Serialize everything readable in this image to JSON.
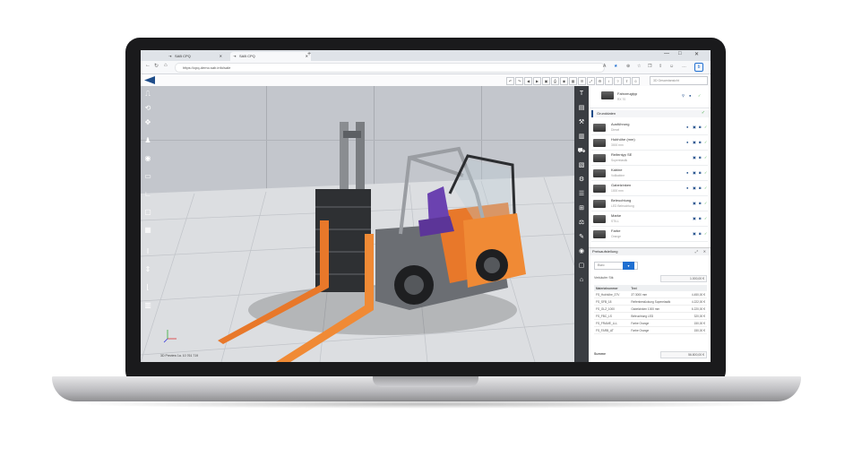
{
  "browser": {
    "tabs": [
      {
        "label": "SAB CPQ",
        "icon": "link-icon",
        "active": false
      },
      {
        "label": "SAB CPQ",
        "icon": "link-icon",
        "active": true
      }
    ],
    "new_tab": "+",
    "window_controls": [
      "—",
      "□",
      "✕"
    ],
    "url": "https://cpq-demo.sab.info/sale"
  },
  "viewport": {
    "coordinates": "3D Preview 1a. 10 761 719"
  },
  "toolbar": {
    "search_placeholder": "3D Gesamtansicht"
  },
  "right_panel": {
    "header": {
      "title": "Fahrzeugtyp",
      "subtitle": "RX 70"
    },
    "section_label": "Grunddaten",
    "items": [
      {
        "title": "Ausführung",
        "subtitle": "Diesel"
      },
      {
        "title": "Hubhöhe (mm)",
        "subtitle": "3000 mm"
      },
      {
        "title": "Reifentyp SE",
        "subtitle": "Superelastik"
      },
      {
        "title": "Kabine",
        "subtitle": "Vollkabine"
      },
      {
        "title": "Gabelzinken",
        "subtitle": "1000 mm"
      },
      {
        "title": "Beleuchtung",
        "subtitle": "LED Beleuchtung"
      },
      {
        "title": "Marke",
        "subtitle": "STILL"
      },
      {
        "title": "Farbe",
        "subtitle": "Orange"
      }
    ]
  },
  "pricing": {
    "title": "Preisaufstellung",
    "select_value": "Euro",
    "unit_label": "Verkäufer Stk",
    "unit_value": "1.000,00 €",
    "columns": [
      "Materialnummer",
      "Text"
    ],
    "rows": [
      {
        "material": "FS_Hubhöhe_3TV",
        "text": "3T 3000 mm",
        "price": "4.450,00 €"
      },
      {
        "material": "FS_SFB_18",
        "text": "Reifenbestückung Superelastik",
        "price": "4.222,00 €"
      },
      {
        "material": "FS_GLZ_1000",
        "text": "Gabelzinken 1000 mm",
        "price": "6.220,00 €"
      },
      {
        "material": "FS_FBC_LS",
        "text": "Beleuchtung LED",
        "price": "320,00 €"
      },
      {
        "material": "FS_FRAME_LLL",
        "text": "Farbe Orange",
        "price": "150,00 €"
      },
      {
        "material": "FS_FARB_AT",
        "text": "Farbe Orange",
        "price": "150,00 €"
      }
    ],
    "total_label": "Summe",
    "total_value": "56.800,00 €"
  }
}
